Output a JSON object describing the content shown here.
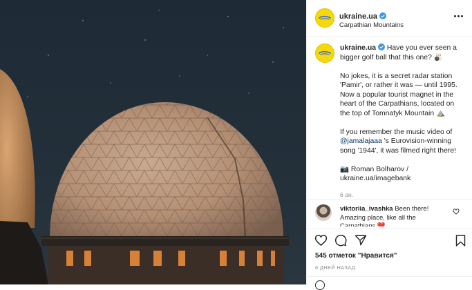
{
  "post": {
    "username": "ukraine.ua",
    "location": "Carpathian Mountains",
    "caption": {
      "username": "ukraine.ua",
      "line1": "Have you ever seen a bigger golf ball that this one? 🎳",
      "para2": "No jokes, it is a secret radar station 'Pamir', or rather it was — until 1995. Now a popular tourist magnet in the heart of the Carpathians, located on the top of Tomnatyk Mountain ⛰️",
      "para3_before": "If you remember the music video of ",
      "para3_mention": "@jamalajaaa",
      "para3_after": " 's Eurovision-winning song '1944', it was filmed right there!",
      "credit_icon": "📷",
      "credit_line1": "Roman Bolharov /",
      "credit_line2": "ukraine.ua/imagebank",
      "age": "6 дн."
    },
    "comment": {
      "username": "viktoriia_ivashka",
      "text": "Been there! Amazing place, like all the Carpathians ❤️"
    },
    "likes": {
      "count": "545",
      "label_before": " отметок ",
      "label_quoted": "\"Нравится\""
    },
    "date": "6 ДНЕЙ НАЗАД"
  },
  "colors": {
    "brand_yellow": "#f5d90a",
    "brand_blue": "#3d6fd8",
    "verified_blue": "#3897f0",
    "link": "#00376b",
    "muted": "#8e8e8e"
  },
  "icons": {
    "verified": "verified-badge-icon",
    "more": "more-options-icon",
    "like": "heart-icon",
    "comment": "comment-icon",
    "share": "paper-plane-icon",
    "save": "bookmark-icon"
  }
}
